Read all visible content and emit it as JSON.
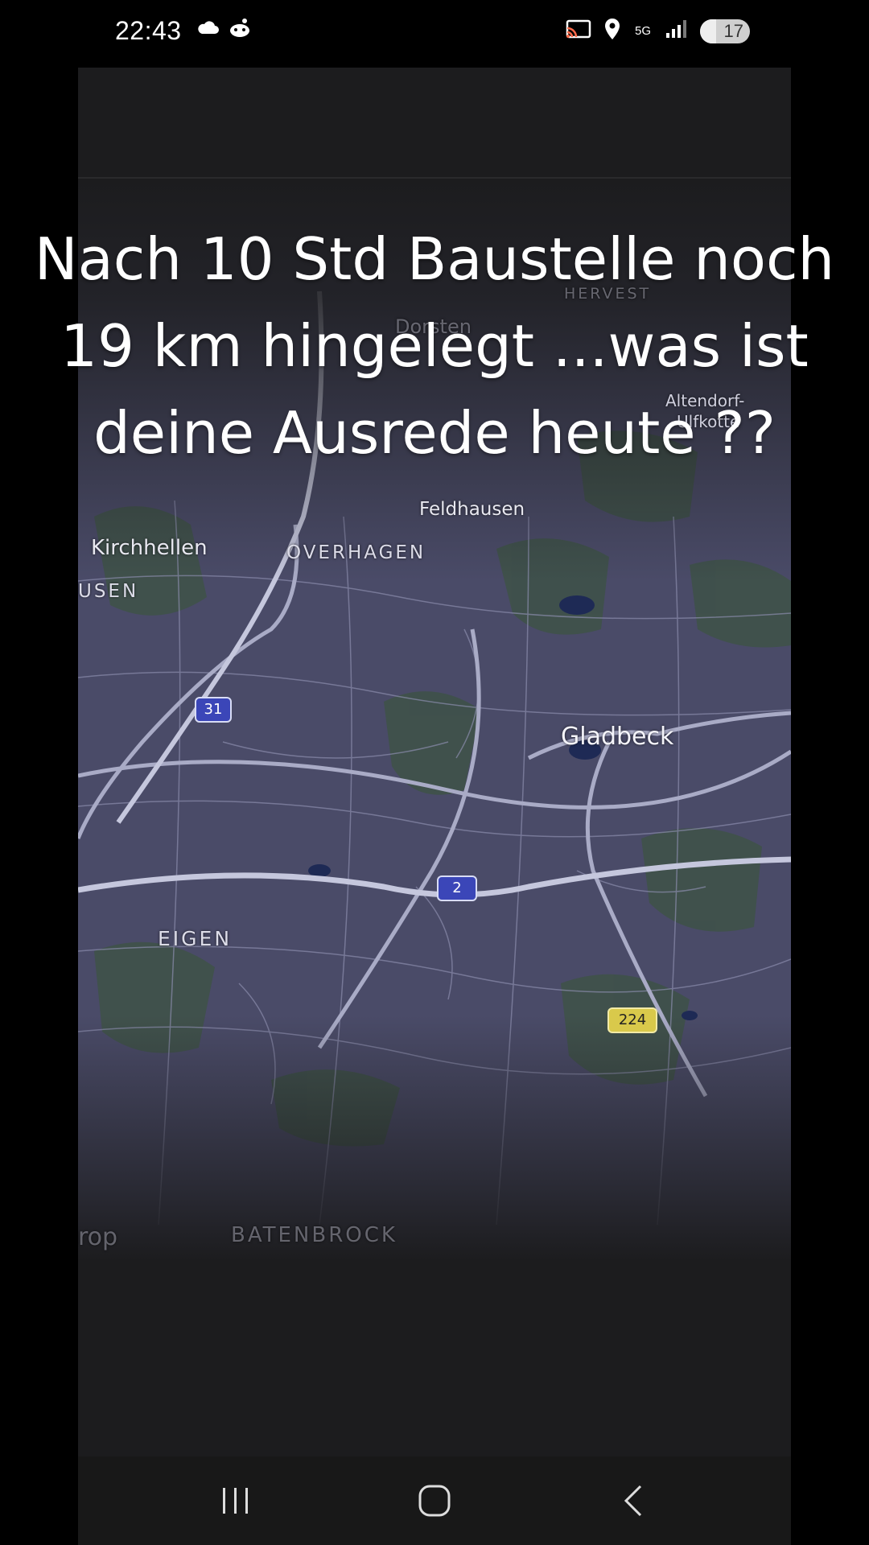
{
  "status_bar": {
    "time": "22:43",
    "notification_icons": [
      "cloud-icon",
      "reddit-icon"
    ],
    "right_icons": [
      "cast-icon",
      "location-icon",
      "5g-icon",
      "signal-icon"
    ],
    "network": "5G",
    "battery": "17"
  },
  "video": {
    "overlay_caption_lines": [
      "Nach 10 Std Baustelle noch",
      "19 km hingelegt ...was ist",
      "deine Ausrede heute ??"
    ],
    "map": {
      "labels": {
        "dorsten": "Dorsten",
        "hervest": "HERVEST",
        "altendorf": "Altendorf-",
        "ulfkotte": "Ulfkotte",
        "feldhausen": "Feldhausen",
        "kirchhellen": "Kirchhellen",
        "overhagen": "OVERHAGEN",
        "usen": "USEN",
        "gladbeck": "Gladbeck",
        "eigen": "EIGEN",
        "batenbrock": "BATENBROCK",
        "trop": "rop"
      },
      "road_shields": {
        "a31": "31",
        "a2": "2",
        "b224": "224"
      },
      "colors": {
        "map_base": "#4a4b68",
        "roads": "#a9abc6",
        "green_areas": "#3e5248",
        "water": "#1e2a55"
      }
    }
  },
  "nav_bar": {
    "buttons": [
      "recents-button",
      "home-button",
      "back-button"
    ]
  }
}
